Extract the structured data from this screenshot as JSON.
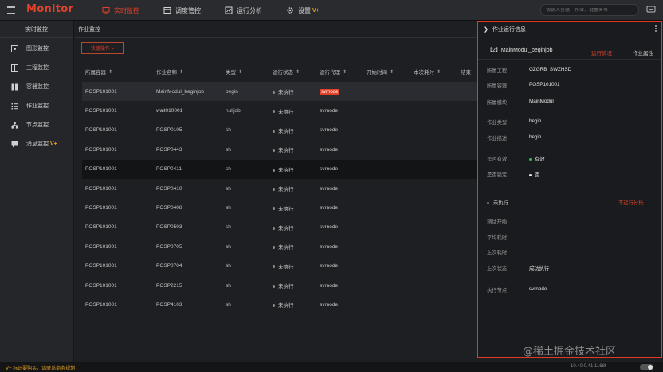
{
  "app": {
    "brand": "Monitor",
    "nav": [
      {
        "label": "实时监控",
        "icon": "monitor-icon",
        "active": true
      },
      {
        "label": "调度管控",
        "icon": "schedule-icon",
        "active": false
      },
      {
        "label": "运行分析",
        "icon": "analysis-icon",
        "active": false
      },
      {
        "label": "设置",
        "icon": "gear-icon",
        "active": false,
        "badge": "V+"
      }
    ],
    "search_placeholder": "请输入容器、作业、批量名等",
    "accent": "#e0422a"
  },
  "sidebar": {
    "header": "实时监控",
    "items": [
      {
        "label": "图形监控",
        "icon": "graph-icon"
      },
      {
        "label": "工程监控",
        "icon": "project-icon"
      },
      {
        "label": "容器监控",
        "icon": "container-icon"
      },
      {
        "label": "作业监控",
        "icon": "job-list-icon"
      },
      {
        "label": "节点监控",
        "icon": "node-icon"
      },
      {
        "label": "消息监控",
        "icon": "message-icon",
        "badge": "V+"
      }
    ]
  },
  "main": {
    "breadcrumb": "作业监控",
    "action_button": "快捷操作 >",
    "columns": [
      "所属容器",
      "作业名称",
      "类型",
      "运行状态",
      "运行代理",
      "开始时间",
      "本次耗时",
      "结束"
    ],
    "rows": [
      {
        "container": "POSP101001",
        "name": "MainModul_beginjob",
        "type": "begin",
        "status": "未执行",
        "agent": "svrnode",
        "agent_tag": true
      },
      {
        "container": "POSP101001",
        "name": "wait010001",
        "type": "nulljob",
        "status": "未执行",
        "agent": "svrnode",
        "agent_tag": false
      },
      {
        "container": "POSP101001",
        "name": "POSP0105",
        "type": "sh",
        "status": "未执行",
        "agent": "svrnode",
        "agent_tag": false
      },
      {
        "container": "POSP101001",
        "name": "POSP0443",
        "type": "sh",
        "status": "未执行",
        "agent": "svrnode",
        "agent_tag": false
      },
      {
        "container": "POSP101001",
        "name": "POSP0411",
        "type": "sh",
        "status": "未执行",
        "agent": "svrnode",
        "agent_tag": false
      },
      {
        "container": "POSP101001",
        "name": "POSP0410",
        "type": "sh",
        "status": "未执行",
        "agent": "svrnode",
        "agent_tag": false
      },
      {
        "container": "POSP101001",
        "name": "POSP0408",
        "type": "sh",
        "status": "未执行",
        "agent": "svrnode",
        "agent_tag": false
      },
      {
        "container": "POSP101001",
        "name": "POSP0503",
        "type": "sh",
        "status": "未执行",
        "agent": "svrnode",
        "agent_tag": false
      },
      {
        "container": "POSP101001",
        "name": "POSP0705",
        "type": "sh",
        "status": "未执行",
        "agent": "svrnode",
        "agent_tag": false
      },
      {
        "container": "POSP101001",
        "name": "POSP0704",
        "type": "sh",
        "status": "未执行",
        "agent": "svrnode",
        "agent_tag": false
      },
      {
        "container": "POSP101001",
        "name": "POSP2215",
        "type": "sh",
        "status": "未执行",
        "agent": "svrnode",
        "agent_tag": false
      },
      {
        "container": "POSP101001",
        "name": "POSP4103",
        "type": "sh",
        "status": "未执行",
        "agent": "svrnode",
        "agent_tag": false
      }
    ]
  },
  "panel": {
    "title": "作业运行信息",
    "job_title": "【2】MainModul_beginjob",
    "tabs": [
      "运行情况",
      "作业属性"
    ],
    "fields": [
      {
        "key": "所属工程",
        "value": "GZGRB_SWZHSD"
      },
      {
        "key": "所属容器",
        "value": "POSP101001"
      },
      {
        "key": "所属模块",
        "value": "MainModul"
      },
      {
        "key": "作业类型",
        "value": "begin"
      },
      {
        "key": "作业描述",
        "value": "begin"
      },
      {
        "key": "是否有效",
        "value": "有效"
      },
      {
        "key": "是否锁定",
        "value": "否"
      }
    ],
    "status": "未执行",
    "analysis_link": "不运行分析",
    "run_fields": [
      {
        "key": "预估开始",
        "value": ""
      },
      {
        "key": "平均耗时",
        "value": ""
      },
      {
        "key": "上次耗时",
        "value": ""
      },
      {
        "key": "上次状态",
        "value": "成功执行"
      },
      {
        "key": "执行节点",
        "value": "svrnode"
      }
    ]
  },
  "footer": {
    "notice": "V+ 标识要购买，请联系商务规划",
    "ip": "10.40.0.41:1168f"
  },
  "watermark": "@稀土掘金技术社区"
}
